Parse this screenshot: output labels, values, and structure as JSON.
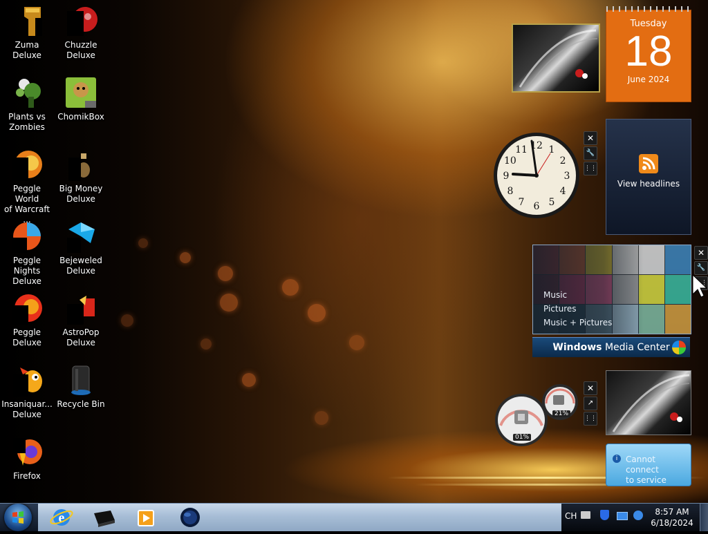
{
  "desktop_icons": [
    {
      "label_line1": "Zuma Deluxe",
      "label_line2": ""
    },
    {
      "label_line1": "Chuzzle",
      "label_line2": "Deluxe"
    },
    {
      "label_line1": "Plants vs",
      "label_line2": "Zombies"
    },
    {
      "label_line1": "ChomikBox",
      "label_line2": ""
    },
    {
      "label_line1": "Peggle World",
      "label_line2": "of Warcraft ..."
    },
    {
      "label_line1": "Big Money",
      "label_line2": "Deluxe"
    },
    {
      "label_line1": "Peggle Nights",
      "label_line2": "Deluxe"
    },
    {
      "label_line1": "Bejeweled",
      "label_line2": "Deluxe"
    },
    {
      "label_line1": "Peggle Deluxe",
      "label_line2": ""
    },
    {
      "label_line1": "AstroPop",
      "label_line2": "Deluxe"
    },
    {
      "label_line1": "Insaniquar...",
      "label_line2": "Deluxe"
    },
    {
      "label_line1": "Recycle Bin",
      "label_line2": ""
    },
    {
      "label_line1": "Firefox",
      "label_line2": ""
    }
  ],
  "calendar": {
    "day_name": "Tuesday",
    "day": "18",
    "month_year": "June 2024"
  },
  "clock": {
    "numerals": [
      "12",
      "1",
      "2",
      "3",
      "4",
      "5",
      "6",
      "7",
      "8",
      "9",
      "10",
      "11"
    ]
  },
  "feed": {
    "label": "View headlines"
  },
  "media_center": {
    "menu": [
      "Music",
      "Pictures",
      "Music + Pictures"
    ],
    "brand_bold": "Windows",
    "brand_light": " Media Center"
  },
  "cpu_meter": {
    "cpu": "01%",
    "memory": "21%"
  },
  "weather": {
    "line1": "Cannot connect",
    "line2": "to service"
  },
  "gadget_controls": {
    "close": "✕",
    "options": "🔧",
    "drag": "⋮⋮"
  },
  "tray": {
    "lang": "CH",
    "time": "8:57 AM",
    "date": "6/18/2024"
  },
  "colors": {
    "calendar_orange": "#e36d12",
    "media_center_blue": "#0b3b6b",
    "weather_blue": "#6bbbe8"
  }
}
